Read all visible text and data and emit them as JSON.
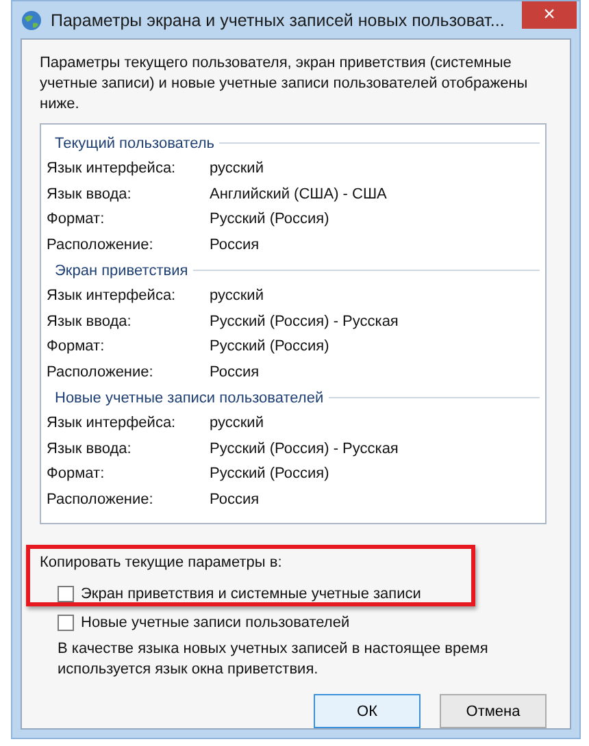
{
  "window": {
    "title": "Параметры экрана и учетных записей новых пользоват...",
    "close": "×"
  },
  "intro": "Параметры текущего пользователя, экран приветствия (системные учетные записи) и новые учетные записи пользователей отображены ниже.",
  "sections": [
    {
      "title": "Текущий пользователь",
      "rows": [
        {
          "label": "Язык интерфейса:",
          "value": "русский"
        },
        {
          "label": "Язык ввода:",
          "value": "Английский (США) - США"
        },
        {
          "label": "Формат:",
          "value": "Русский (Россия)"
        },
        {
          "label": "Расположение:",
          "value": "Россия"
        }
      ]
    },
    {
      "title": "Экран приветствия",
      "rows": [
        {
          "label": "Язык интерфейса:",
          "value": "русский"
        },
        {
          "label": "Язык ввода:",
          "value": "Русский (Россия) - Русская"
        },
        {
          "label": "Формат:",
          "value": "Русский (Россия)"
        },
        {
          "label": "Расположение:",
          "value": "Россия"
        }
      ]
    },
    {
      "title": "Новые учетные записи пользователей",
      "rows": [
        {
          "label": "Язык интерфейса:",
          "value": "русский"
        },
        {
          "label": "Язык ввода:",
          "value": "Русский (Россия) - Русская"
        },
        {
          "label": "Формат:",
          "value": "Русский (Россия)"
        },
        {
          "label": "Расположение:",
          "value": "Россия"
        }
      ]
    }
  ],
  "copy_label": "Копировать текущие параметры в:",
  "checkboxes": [
    {
      "label": "Экран приветствия и системные учетные записи",
      "checked": false,
      "highlighted": true
    },
    {
      "label": "Новые учетные записи пользователей",
      "checked": false,
      "highlighted": false
    }
  ],
  "note": "В качестве языка новых учетных записей в настоящее время используется язык окна приветствия.",
  "buttons": [
    {
      "label": "ОК",
      "selected": true
    },
    {
      "label": "Отмена",
      "selected": false
    }
  ]
}
